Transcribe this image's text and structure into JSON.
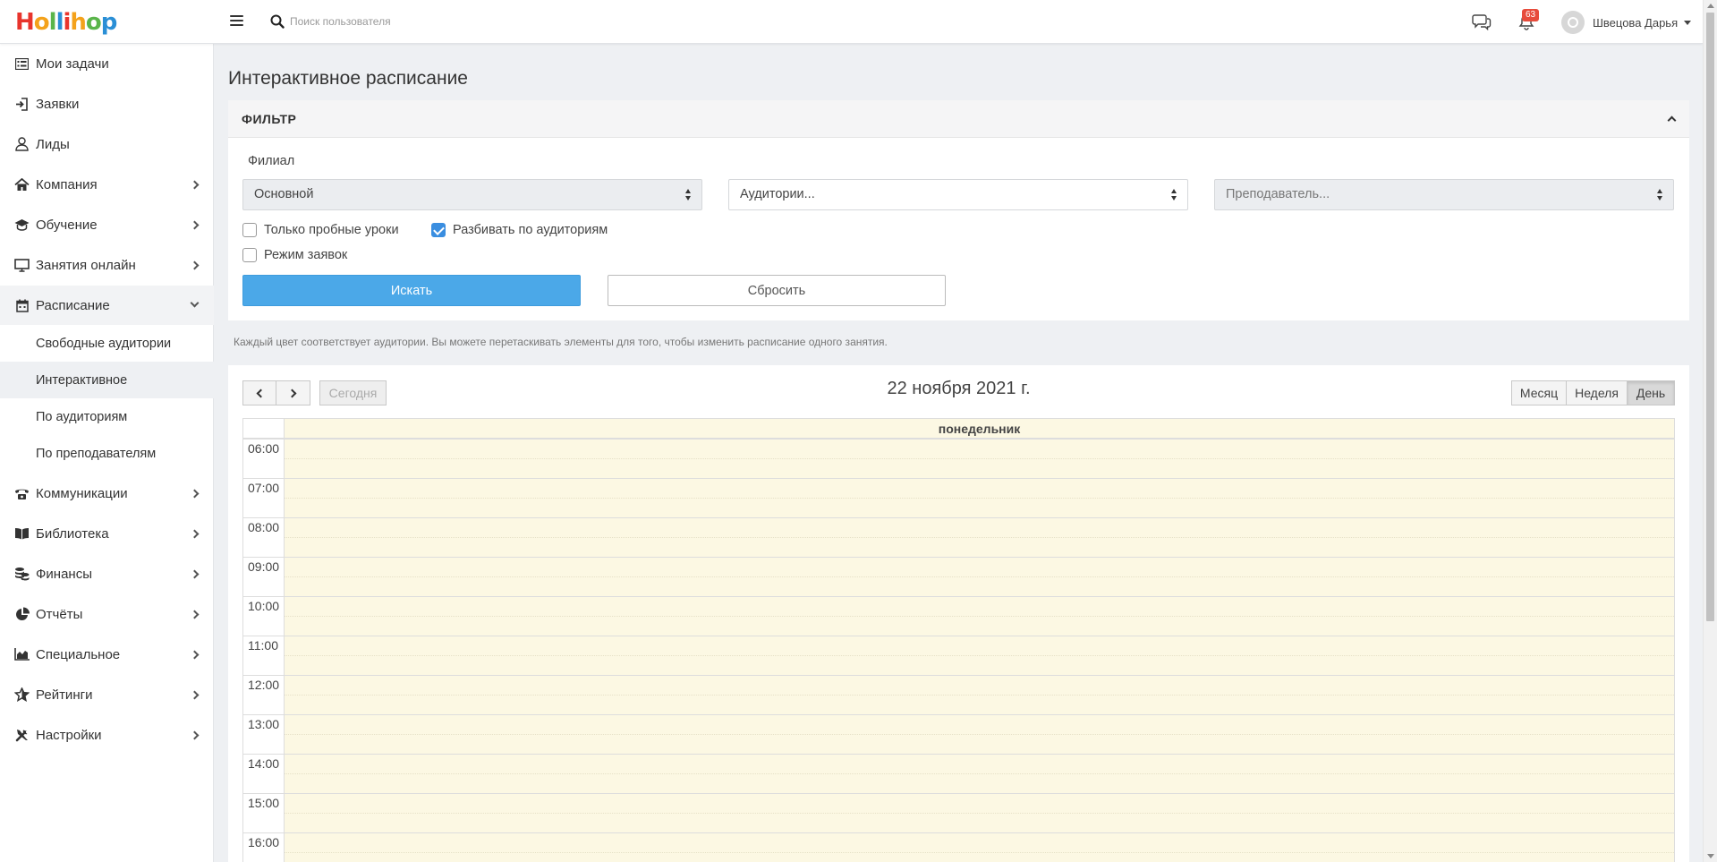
{
  "brand": {
    "logo_letters": [
      {
        "ch": "H",
        "color": "#e8342c"
      },
      {
        "ch": "o",
        "color": "#f4a21b"
      },
      {
        "ch": "l",
        "color": "#5ab54b"
      },
      {
        "ch": "l",
        "color": "#2a8fd6"
      },
      {
        "ch": "i",
        "color": "#e8342c"
      },
      {
        "ch": "h",
        "color": "#f4a21b"
      },
      {
        "ch": "o",
        "color": "#5ab54b"
      },
      {
        "ch": "p",
        "color": "#2a8fd6"
      }
    ]
  },
  "topbar": {
    "search_placeholder": "Поиск пользователя",
    "notifications_count": "63",
    "user_name": "Швецова Дарья"
  },
  "sidebar": {
    "items": [
      {
        "label": "Мои задачи",
        "icon": "list-icon",
        "has_children": false
      },
      {
        "label": "Заявки",
        "icon": "sign-in-icon",
        "has_children": false
      },
      {
        "label": "Лиды",
        "icon": "user-icon",
        "has_children": false
      },
      {
        "label": "Компания",
        "icon": "home-icon",
        "has_children": true
      },
      {
        "label": "Обучение",
        "icon": "graduation-cap-icon",
        "has_children": true
      },
      {
        "label": "Занятия онлайн",
        "icon": "monitor-icon",
        "has_children": true
      },
      {
        "label": "Расписание",
        "icon": "calendar-icon",
        "has_children": true,
        "expanded": true
      },
      {
        "label": "Коммуникации",
        "icon": "phone-icon",
        "has_children": true
      },
      {
        "label": "Библиотека",
        "icon": "book-icon",
        "has_children": true
      },
      {
        "label": "Финансы",
        "icon": "coins-icon",
        "has_children": true
      },
      {
        "label": "Отчёты",
        "icon": "pie-chart-icon",
        "has_children": true
      },
      {
        "label": "Специальное",
        "icon": "area-chart-icon",
        "has_children": true
      },
      {
        "label": "Рейтинги",
        "icon": "star-icon",
        "has_children": true
      },
      {
        "label": "Настройки",
        "icon": "tools-icon",
        "has_children": true
      }
    ],
    "schedule_subitems": [
      {
        "label": "Свободные аудитории",
        "selected": false
      },
      {
        "label": "Интерактивное",
        "selected": true
      },
      {
        "label": "По аудиториям",
        "selected": false
      },
      {
        "label": "По преподавателям",
        "selected": false
      }
    ]
  },
  "page": {
    "title": "Интерактивное расписание"
  },
  "filter": {
    "title": "ФИЛЬТР",
    "branch_label": "Филиал",
    "branch_value": "Основной",
    "rooms_placeholder": "Аудитории...",
    "teacher_placeholder": "Преподаватель...",
    "trial_only_label": "Только пробные уроки",
    "trial_only_checked": false,
    "split_by_rooms_label": "Разбивать по аудиториям",
    "split_by_rooms_checked": true,
    "requests_mode_label": "Режим заявок",
    "requests_mode_checked": false,
    "search_button": "Искать",
    "reset_button": "Сбросить"
  },
  "hint": "Каждый цвет соответствует аудитории. Вы можете перетаскивать элементы для того, чтобы изменить расписание одного занятия.",
  "calendar": {
    "today_button": "Сегодня",
    "date_title": "22 ноября 2021 г.",
    "view_month": "Месяц",
    "view_week": "Неделя",
    "view_day": "День",
    "active_view": "День",
    "day_header": "понедельник",
    "hours": [
      "06:00",
      "07:00",
      "08:00",
      "09:00",
      "10:00",
      "11:00",
      "12:00",
      "13:00",
      "14:00",
      "15:00",
      "16:00"
    ]
  },
  "colors": {
    "accent": "#4ba8e8",
    "today_column": "#fcf8e3",
    "badge": "#e74c3c"
  }
}
